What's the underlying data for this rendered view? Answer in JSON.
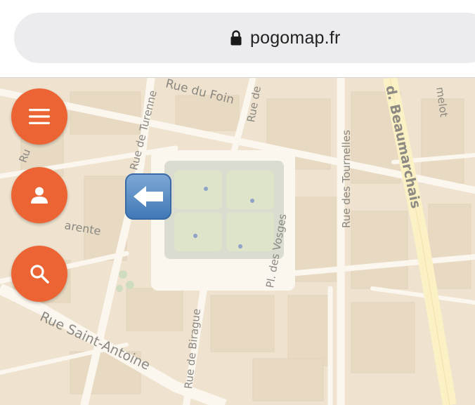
{
  "browser": {
    "url": "pogomap.fr"
  },
  "map": {
    "streets": {
      "rue_du_foin": "Rue du Foin",
      "rue_de_turenne": "Rue de Turenne",
      "rue_des_tournelles": "Rue des Tournelles",
      "bd_beaumarchais": "d. Beaumarchais",
      "rue_de_birague": "Rue de Birague",
      "pl_des_vosges": "Pl. des Vosges",
      "rue_saint_antoine": "Rue Saint-Antoine",
      "charente": "arente",
      "rue_de_top": "Rue de",
      "rue_left": "Ru",
      "amelot": "melot"
    }
  },
  "controls": {
    "menu_icon": "hamburger-icon",
    "profile_icon": "person-icon",
    "search_icon": "search-icon",
    "back_icon": "left-arrow-icon"
  },
  "colors": {
    "fab": "#ec6433",
    "map_bg": "#efe3cf",
    "road": "#fbf7ef",
    "boulevard": "#fbf1c4",
    "square": "#d7dbcc"
  }
}
